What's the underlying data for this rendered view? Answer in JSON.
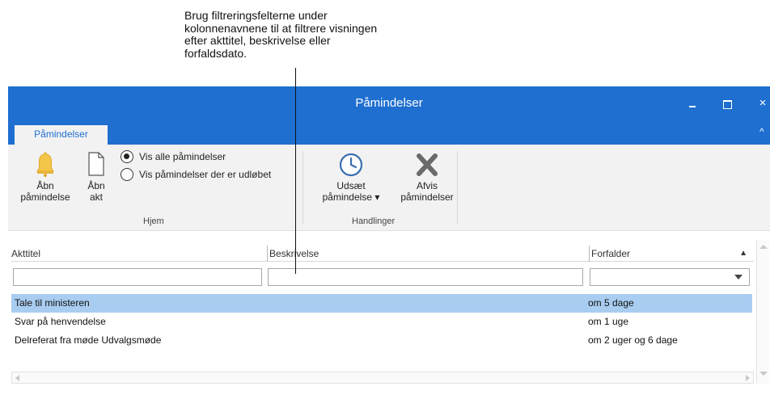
{
  "callout": {
    "line1": "Brug filtreringsfelterne under",
    "line2": "kolonnenavnene til at filtrere visningen",
    "line3": "efter akttitel, beskrivelse eller",
    "line4": "forfaldsdato."
  },
  "window": {
    "title": "Påmindelser",
    "close_glyph": "×",
    "collapse_glyph": "^"
  },
  "ribbon": {
    "tab": "Påmindelser",
    "open_reminder": {
      "line1": "Åbn",
      "line2": "påmindelse",
      "icon": "bell-icon"
    },
    "open_act": {
      "line1": "Åbn",
      "line2": "akt",
      "icon": "document-icon"
    },
    "radio_all": "Vis alle påmindelser",
    "radio_expired": "Vis påmindelser der er udløbet",
    "group_home": "Hjem",
    "postpone": {
      "line1": "Udsæt",
      "line2": "påmindelse ▾",
      "icon": "clock-icon"
    },
    "dismiss": {
      "line1": "Afvis",
      "line2": "påmindelser",
      "icon": "x-icon"
    },
    "group_actions": "Handlinger",
    "accent_color": "#1e6fd0",
    "bell_color": "#f3c64a"
  },
  "grid": {
    "headers": [
      "Akttitel",
      "Beskrivelse",
      "Forfalder"
    ],
    "sort_indicator": "▲",
    "rows": [
      {
        "title": "Tale til ministeren",
        "due": "om 5 dage"
      },
      {
        "title": "Svar på henvendelse",
        "due": "om 1 uge"
      },
      {
        "title": "Delreferat fra møde Udvalgsmøde",
        "due": "om 2 uger og 6 dage"
      }
    ],
    "selected_row_color": "#a9cdf1"
  }
}
